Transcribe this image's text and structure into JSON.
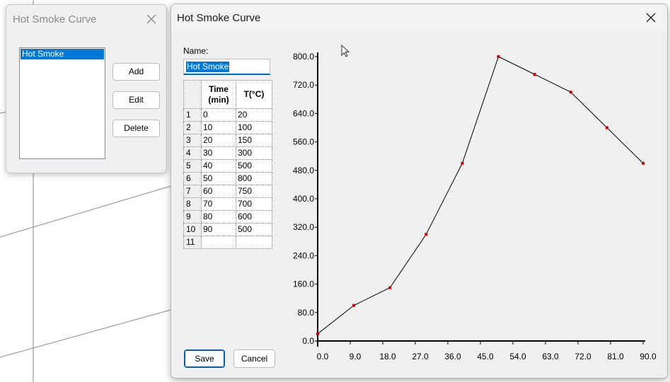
{
  "back_dialog": {
    "title": "Hot Smoke Curve",
    "list_items": [
      "Hot Smoke"
    ],
    "add_label": "Add",
    "edit_label": "Edit",
    "delete_label": "Delete"
  },
  "main_dialog": {
    "title": "Hot Smoke Curve",
    "name_label": "Name:",
    "name_value": "Hot Smoke",
    "table": {
      "headers": [
        "Time\n(min)",
        "T(°C)"
      ],
      "rows": [
        [
          "1",
          "0",
          "20"
        ],
        [
          "2",
          "10",
          "100"
        ],
        [
          "3",
          "20",
          "150"
        ],
        [
          "4",
          "30",
          "300"
        ],
        [
          "5",
          "40",
          "500"
        ],
        [
          "6",
          "50",
          "800"
        ],
        [
          "7",
          "60",
          "750"
        ],
        [
          "8",
          "70",
          "700"
        ],
        [
          "9",
          "80",
          "600"
        ],
        [
          "10",
          "90",
          "500"
        ],
        [
          "11",
          "",
          ""
        ]
      ]
    },
    "save_label": "Save",
    "cancel_label": "Cancel"
  },
  "colors": {
    "selection": "#0078d7",
    "point": "#cc0000",
    "line": "#000000"
  },
  "icons": {
    "close": "close-icon",
    "cursor": "mouse-pointer-icon"
  },
  "chart_data": {
    "type": "line",
    "x": [
      0,
      10,
      20,
      30,
      40,
      50,
      60,
      70,
      80,
      90
    ],
    "series": [
      {
        "values": [
          20,
          100,
          150,
          300,
          500,
          800,
          750,
          700,
          600,
          500
        ]
      }
    ],
    "xticks": [
      "0.0",
      "9.0",
      "18.0",
      "27.0",
      "36.0",
      "45.0",
      "54.0",
      "63.0",
      "72.0",
      "81.0",
      "90.0"
    ],
    "yticks": [
      "0.0",
      "80.0",
      "160.0",
      "240.0",
      "320.0",
      "400.0",
      "480.0",
      "560.0",
      "640.0",
      "720.0",
      "800.0"
    ],
    "xlim": [
      0,
      90
    ],
    "ylim": [
      0,
      800
    ],
    "grid": false,
    "title": "",
    "xlabel": "",
    "ylabel": ""
  }
}
